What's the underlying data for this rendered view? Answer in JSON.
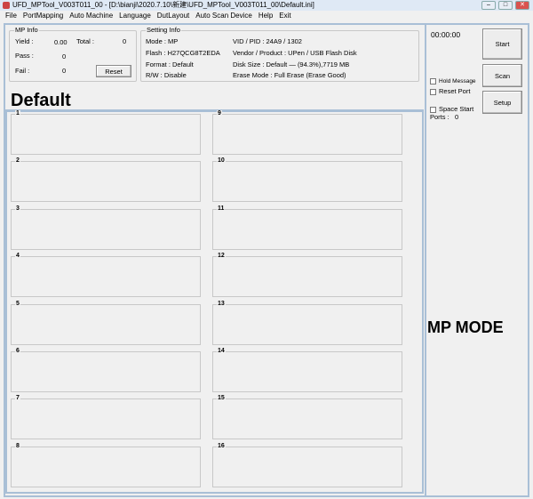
{
  "window": {
    "title": "UFD_MPTool_V003T011_00 - [D:\\bianji\\2020.7.10\\新建\\UFD_MPTool_V003T011_00\\Default.ini]"
  },
  "menu": [
    "File",
    "PortMapping",
    "Auto Machine",
    "Language",
    "DutLayout",
    "Auto Scan Device",
    "Help",
    "Exit"
  ],
  "mp_info": {
    "label": "MP Info",
    "yield_label": "Yield :",
    "yield": "0.00",
    "total_label": "Total :",
    "total": "0",
    "pass_label": "Pass :",
    "pass": "0",
    "fail_label": "Fail :",
    "fail": "0",
    "reset": "Reset"
  },
  "setting_info": {
    "label": "Setting Info",
    "mode": "Mode : MP",
    "flash": "Flash : H27QCG8T2EDA",
    "format": "Format : Default",
    "rw": "R/W : Disable",
    "vidpid": "VID / PID : 24A9 / 1302",
    "vendor": "Vendor / Product : UPen / USB Flash Disk",
    "disk": "Disk Size : Default — (94.3%),7719 MB",
    "erase": "Erase Mode : Full Erase (Erase Good)"
  },
  "profile": "Default",
  "ports": [
    "1",
    "2",
    "3",
    "4",
    "5",
    "6",
    "7",
    "8",
    "9",
    "10",
    "11",
    "12",
    "13",
    "14",
    "15",
    "16"
  ],
  "right": {
    "timer": "00:00:00",
    "start": "Start",
    "scan": "Scan",
    "setup": "Setup",
    "hold": "Hold Message",
    "resetport": "Reset Port",
    "space": "Space Start",
    "ports_label": "Ports :",
    "ports_count": "0",
    "mode": "MP MODE"
  }
}
